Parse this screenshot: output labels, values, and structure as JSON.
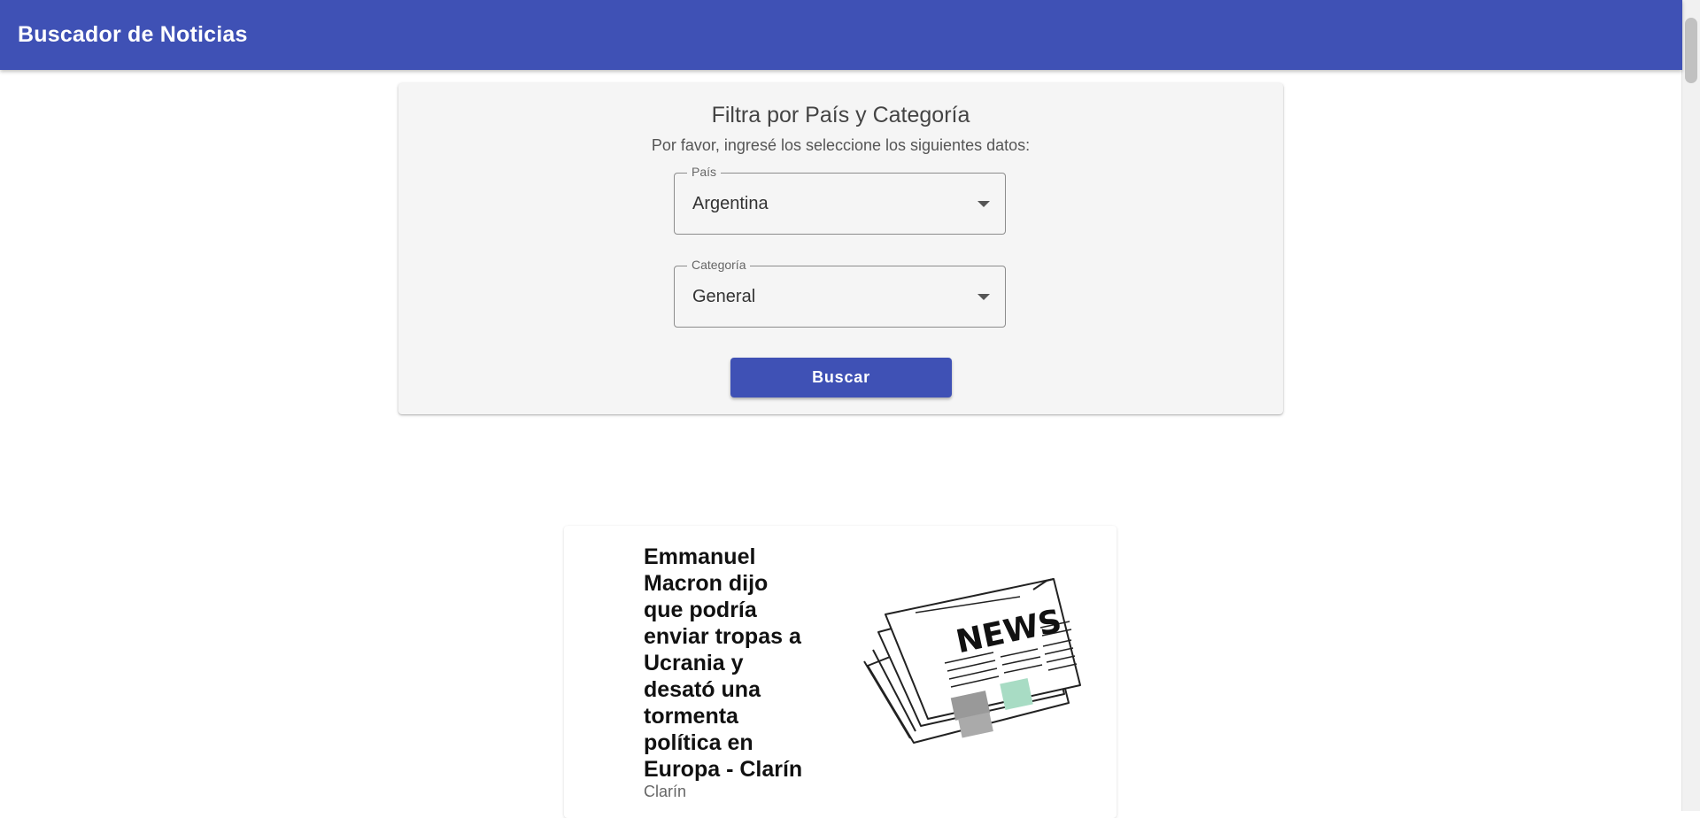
{
  "appbar": {
    "title": "Buscador de Noticias",
    "color": "#3f51b5"
  },
  "filter": {
    "title": "Filtra por País y Categoría",
    "subtitle": "Por favor, ingresé los seleccione los siguientes datos:",
    "country": {
      "label": "País",
      "value": "Argentina"
    },
    "category": {
      "label": "Categoría",
      "value": "General"
    },
    "search_label": "Buscar"
  },
  "news": [
    {
      "title": "Emmanuel Macron dijo que podría enviar tropas a Ucrania y desató una tormenta política en Europa - Clarín",
      "source": "Clarín",
      "image": {
        "icon": "newspaper-illustration",
        "text": "NEWS"
      }
    }
  ]
}
